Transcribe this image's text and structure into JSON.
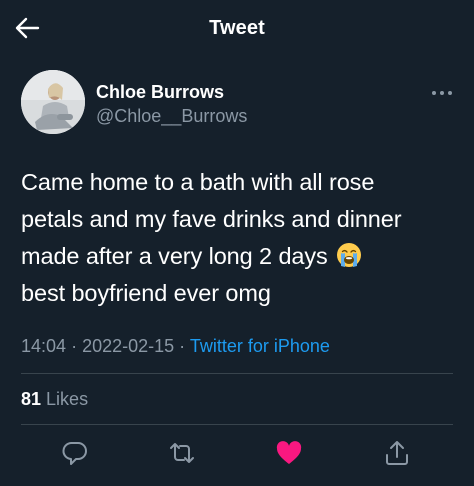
{
  "header": {
    "title": "Tweet",
    "back_icon": "arrow-left-icon"
  },
  "author": {
    "display_name": "Chloe Burrows",
    "handle": "@Chloe__Burrows",
    "more_icon": "more-options-icon"
  },
  "tweet": {
    "lines": [
      "Came home to a bath with all rose",
      "petals and my fave drinks and dinner",
      "made after a very long 2 days",
      "best boyfriend ever omg"
    ],
    "emoji": "loudly-crying-face-emoji"
  },
  "meta": {
    "time": "14:04",
    "separator": "·",
    "date": "2022-02-15",
    "source": "Twitter for iPhone"
  },
  "stats": {
    "likes_count": "81",
    "likes_label": "Likes"
  },
  "actions": [
    {
      "name": "reply-icon"
    },
    {
      "name": "retweet-icon"
    },
    {
      "name": "like-icon",
      "liked": true,
      "color": "#f91880"
    },
    {
      "name": "share-icon"
    }
  ],
  "colors": {
    "background": "#15202b",
    "text": "#ffffff",
    "secondary_text": "#8b98a5",
    "link": "#1d9bf0",
    "divider": "#38444d",
    "like": "#f91880"
  }
}
